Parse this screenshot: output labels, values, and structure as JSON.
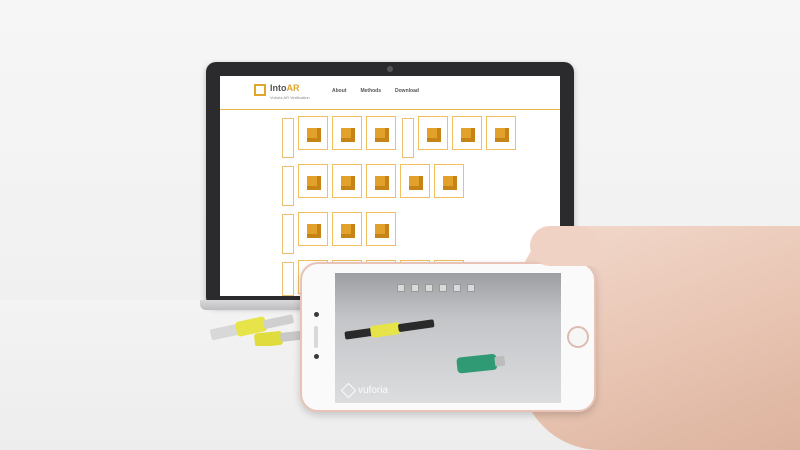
{
  "website": {
    "brand_main": "Into",
    "brand_accent": "AR",
    "tagline": "Vuforia AR Verification",
    "nav": [
      "About",
      "Methods",
      "Download"
    ]
  },
  "ar_watermark": {
    "icon": "vuforia-logo-icon",
    "text": "vuforia"
  },
  "colors": {
    "accent": "#e0a62b",
    "laptop_bezel": "#2b2b2d",
    "phone_frame": "#e9c3b5",
    "battery_yellow": "#e7e44a",
    "battery_green": "#2f9a73"
  }
}
